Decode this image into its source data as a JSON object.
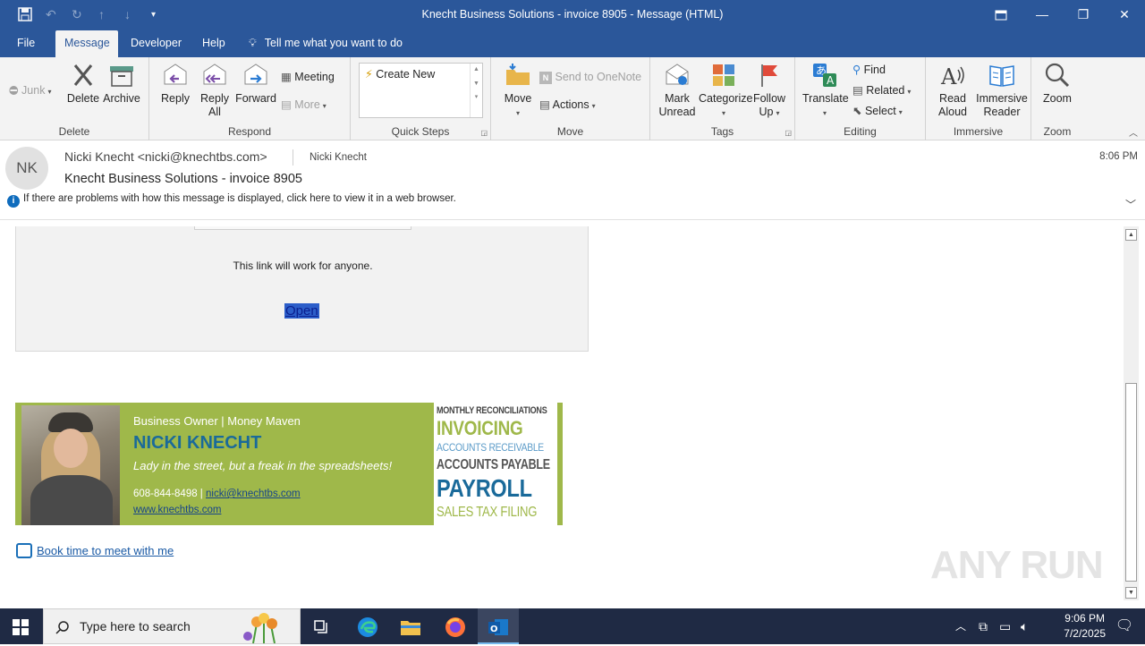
{
  "window": {
    "title": "Knecht Business Solutions - invoice 8905  -  Message (HTML)"
  },
  "tabs": [
    "File",
    "Message",
    "Developer",
    "Help"
  ],
  "tell_me": "Tell me what you want to do",
  "ribbon": {
    "delete_group": {
      "label": "Delete",
      "junk": "Junk",
      "delete": "Delete",
      "archive": "Archive"
    },
    "respond_group": {
      "label": "Respond",
      "reply": "Reply",
      "reply_all_1": "Reply",
      "reply_all_2": "All",
      "forward": "Forward",
      "meeting": "Meeting",
      "more": "More"
    },
    "quick_steps": {
      "label": "Quick Steps",
      "create_new": "Create New"
    },
    "move_group": {
      "label": "Move",
      "move": "Move",
      "send_onenote": "Send to OneNote",
      "actions": "Actions"
    },
    "tags_group": {
      "label": "Tags",
      "mark_unread_1": "Mark",
      "mark_unread_2": "Unread",
      "categorize": "Categorize",
      "follow_up_1": "Follow",
      "follow_up_2": "Up"
    },
    "editing_group": {
      "label": "Editing",
      "translate": "Translate",
      "find": "Find",
      "related": "Related",
      "select": "Select"
    },
    "immersive_group": {
      "label": "Immersive",
      "read_aloud_1": "Read",
      "read_aloud_2": "Aloud",
      "immersive_reader_1": "Immersive",
      "immersive_reader_2": "Reader"
    },
    "zoom_group": {
      "label": "Zoom",
      "zoom": "Zoom"
    }
  },
  "message": {
    "avatar_initials": "NK",
    "from": "Nicki Knecht <nicki@knechtbs.com>",
    "to": "Nicki Knecht",
    "subject": "Knecht Business Solutions - invoice 8905",
    "time": "8:06 PM",
    "info_bar": "If there are problems with how this message is displayed, click here to view it in a web browser."
  },
  "body": {
    "link_note": "This link will work for anyone.",
    "open_link": "Open",
    "signature": {
      "role": "Business Owner | Money Maven",
      "name": "NICKI KNECHT",
      "quote": "Lady in the street, but a freak in the spreadsheets!",
      "phone": "608-844-8498 | ",
      "email": "nicki@knechtbs.com",
      "website": "www.knechtbs.com",
      "services": [
        "MONTHLY RECONCILIATIONS",
        "INVOICING",
        "ACCOUNTS RECEIVABLE",
        "ACCOUNTS PAYABLE",
        "PAYROLL",
        "SALES TAX FILING"
      ]
    },
    "book_link": "Book time to meet with me"
  },
  "taskbar": {
    "search_placeholder": "Type here to search",
    "time": "9:06 PM",
    "date": "7/2/2025"
  },
  "watermark": "ANY RUN",
  "colors": {
    "accent": "#2b579a",
    "signature_green": "#9fb84a",
    "link_blue": "#1a5aa5"
  }
}
